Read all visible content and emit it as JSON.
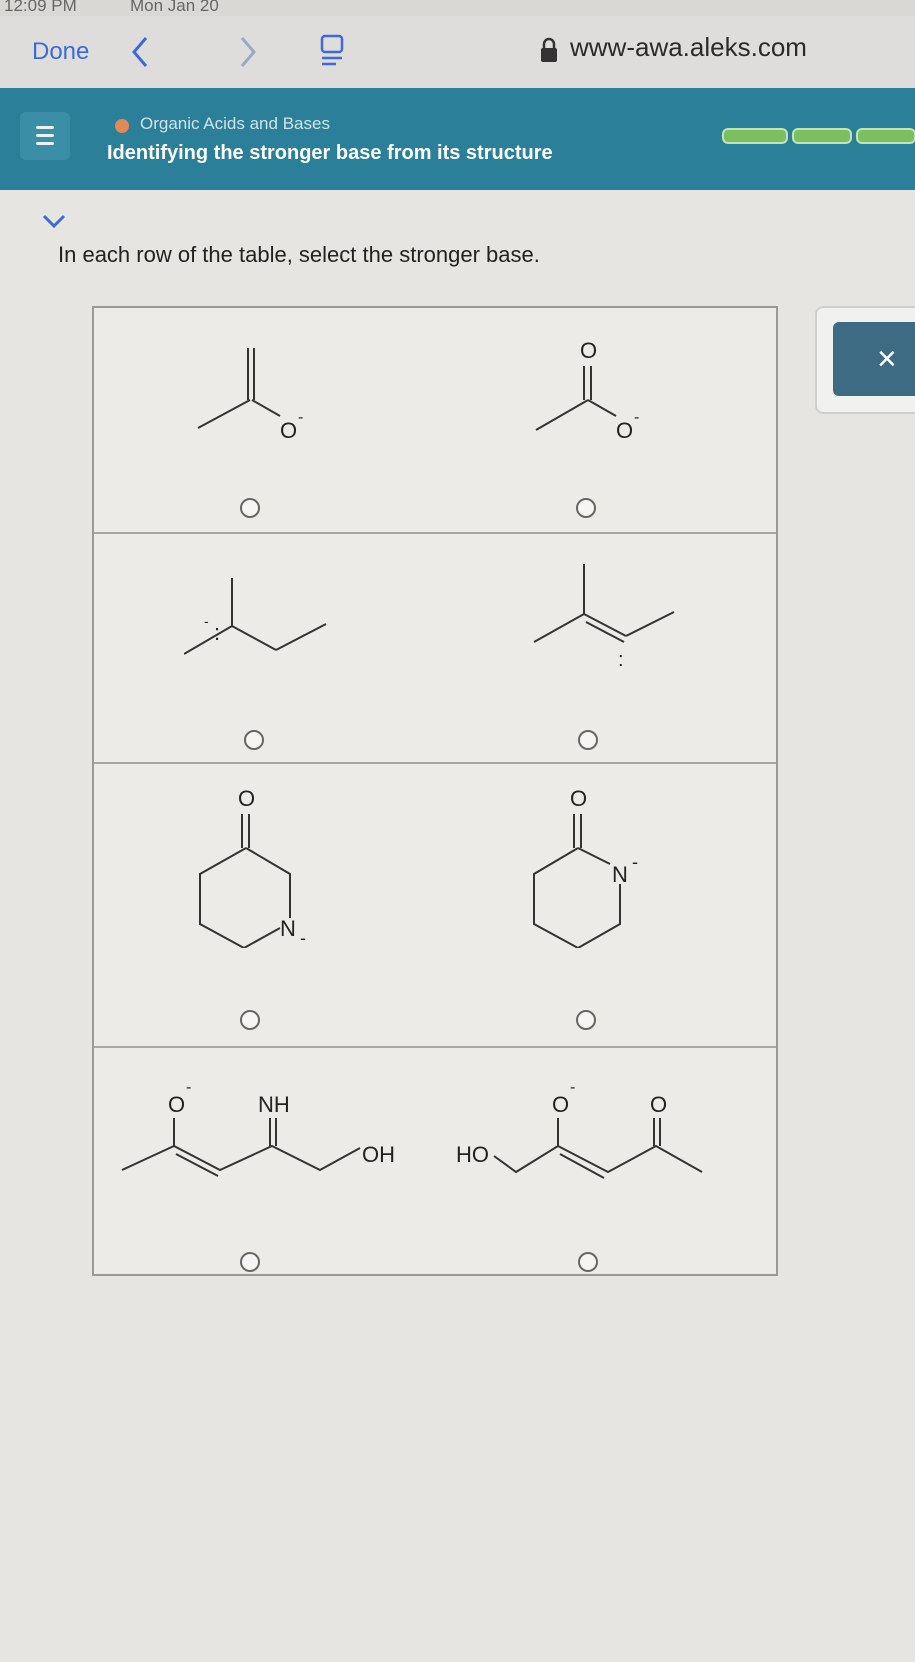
{
  "status_bar": {
    "time": "12:09 PM",
    "date": "Mon Jan 20"
  },
  "browser": {
    "done_label": "Done",
    "url": "www-awa.aleks.com"
  },
  "header": {
    "topic": "Organic Acids and Bases",
    "title": "Identifying the stronger base from its structure"
  },
  "instruction": "In each row of the table, select the stronger base.",
  "close_label": "×",
  "rows": [
    {
      "left": {
        "atoms": [
          "O",
          "-"
        ]
      },
      "right": {
        "atoms": [
          "O",
          "O",
          "-"
        ]
      }
    },
    {
      "left": {
        "atoms": [
          "-",
          ":"
        ]
      },
      "right": {
        "atoms": [
          ":"
        ]
      }
    },
    {
      "left": {
        "atoms": [
          "O",
          "N",
          "-"
        ]
      },
      "right": {
        "atoms": [
          "O",
          "N",
          "-"
        ]
      }
    },
    {
      "left": {
        "atoms": [
          "O",
          "-",
          "NH",
          "OH"
        ]
      },
      "right": {
        "atoms": [
          "HO",
          "O",
          "-",
          "O"
        ]
      }
    }
  ],
  "colors": {
    "header": "#2b7f98",
    "link": "#3d6ad6",
    "progress": "#7cbf60",
    "close_button": "#3d6b84"
  }
}
